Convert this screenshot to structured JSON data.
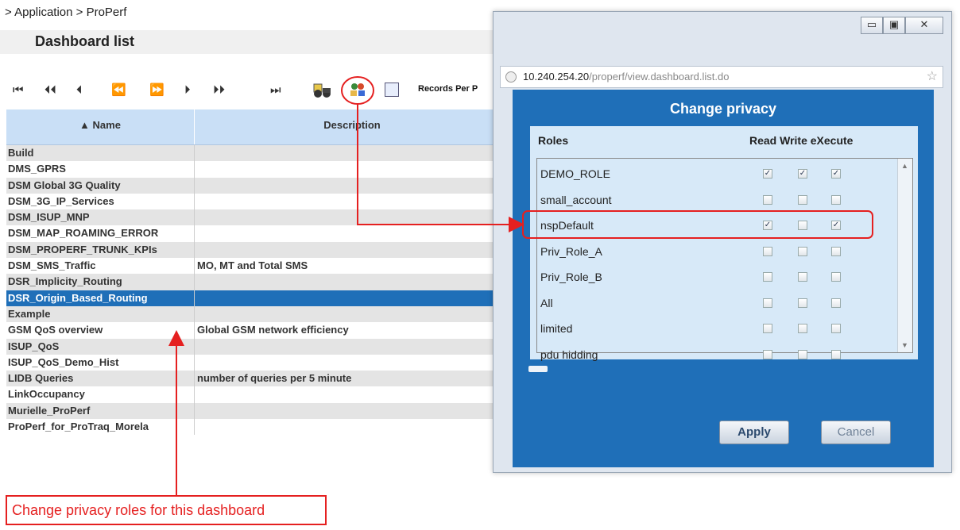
{
  "breadcrumb": "> Application  > ProPerf",
  "page_title": "Dashboard list",
  "toolbar": {
    "nav_icons": [
      "⏮",
      "⏴⏴",
      "⏴",
      "⏪",
      "⏩",
      "⏵",
      "⏵⏵",
      "⏭"
    ],
    "records_label": "Records Per P"
  },
  "grid": {
    "col_name": "▲  Name",
    "col_desc": "Description",
    "rows": [
      {
        "name": "Build",
        "desc": ""
      },
      {
        "name": "DMS_GPRS",
        "desc": ""
      },
      {
        "name": "DSM Global 3G Quality",
        "desc": ""
      },
      {
        "name": "DSM_3G_IP_Services",
        "desc": ""
      },
      {
        "name": "DSM_ISUP_MNP",
        "desc": ""
      },
      {
        "name": "DSM_MAP_ROAMING_ERROR",
        "desc": ""
      },
      {
        "name": "DSM_PROPERF_TRUNK_KPIs",
        "desc": ""
      },
      {
        "name": "DSM_SMS_Traffic",
        "desc": "MO, MT and Total SMS"
      },
      {
        "name": "DSR_Implicity_Routing",
        "desc": ""
      },
      {
        "name": "DSR_Origin_Based_Routing",
        "desc": ""
      },
      {
        "name": "Example",
        "desc": ""
      },
      {
        "name": "GSM QoS overview",
        "desc": "Global GSM network efficiency"
      },
      {
        "name": "ISUP_QoS",
        "desc": ""
      },
      {
        "name": "ISUP_QoS_Demo_Hist",
        "desc": ""
      },
      {
        "name": "LIDB Queries",
        "desc": "number of queries per 5 minute"
      },
      {
        "name": "LinkOccupancy",
        "desc": ""
      },
      {
        "name": "Murielle_ProPerf",
        "desc": ""
      },
      {
        "name": "ProPerf_for_ProTraq_Morela",
        "desc": ""
      }
    ]
  },
  "annotation": "Change privacy roles for this dashboard",
  "popup": {
    "window_buttons": {
      "minimize": "▭",
      "restore": "▣",
      "close": "✕"
    },
    "address_host": "10.240.254.20",
    "address_path": "/properf/view.dashboard.list.do",
    "title": "Change privacy",
    "header_roles": "Roles",
    "header_perms": "Read Write eXecute",
    "roles": [
      {
        "name": "DEMO_ROLE",
        "read": true,
        "write": true,
        "execute": true
      },
      {
        "name": "small_account",
        "read": false,
        "write": false,
        "execute": false
      },
      {
        "name": "nspDefault",
        "read": true,
        "write": false,
        "execute": true
      },
      {
        "name": "Priv_Role_A",
        "read": false,
        "write": false,
        "execute": false
      },
      {
        "name": "Priv_Role_B",
        "read": false,
        "write": false,
        "execute": false
      },
      {
        "name": "All",
        "read": false,
        "write": false,
        "execute": false
      },
      {
        "name": "limited",
        "read": false,
        "write": false,
        "execute": false
      },
      {
        "name": "pdu hidding",
        "read": false,
        "write": false,
        "execute": false
      }
    ],
    "apply_label": "Apply",
    "cancel_label": "Cancel"
  },
  "colors": {
    "accent_blue": "#1f6fb8",
    "annotation_red": "#e52020",
    "grid_header": "#c9dff6"
  }
}
